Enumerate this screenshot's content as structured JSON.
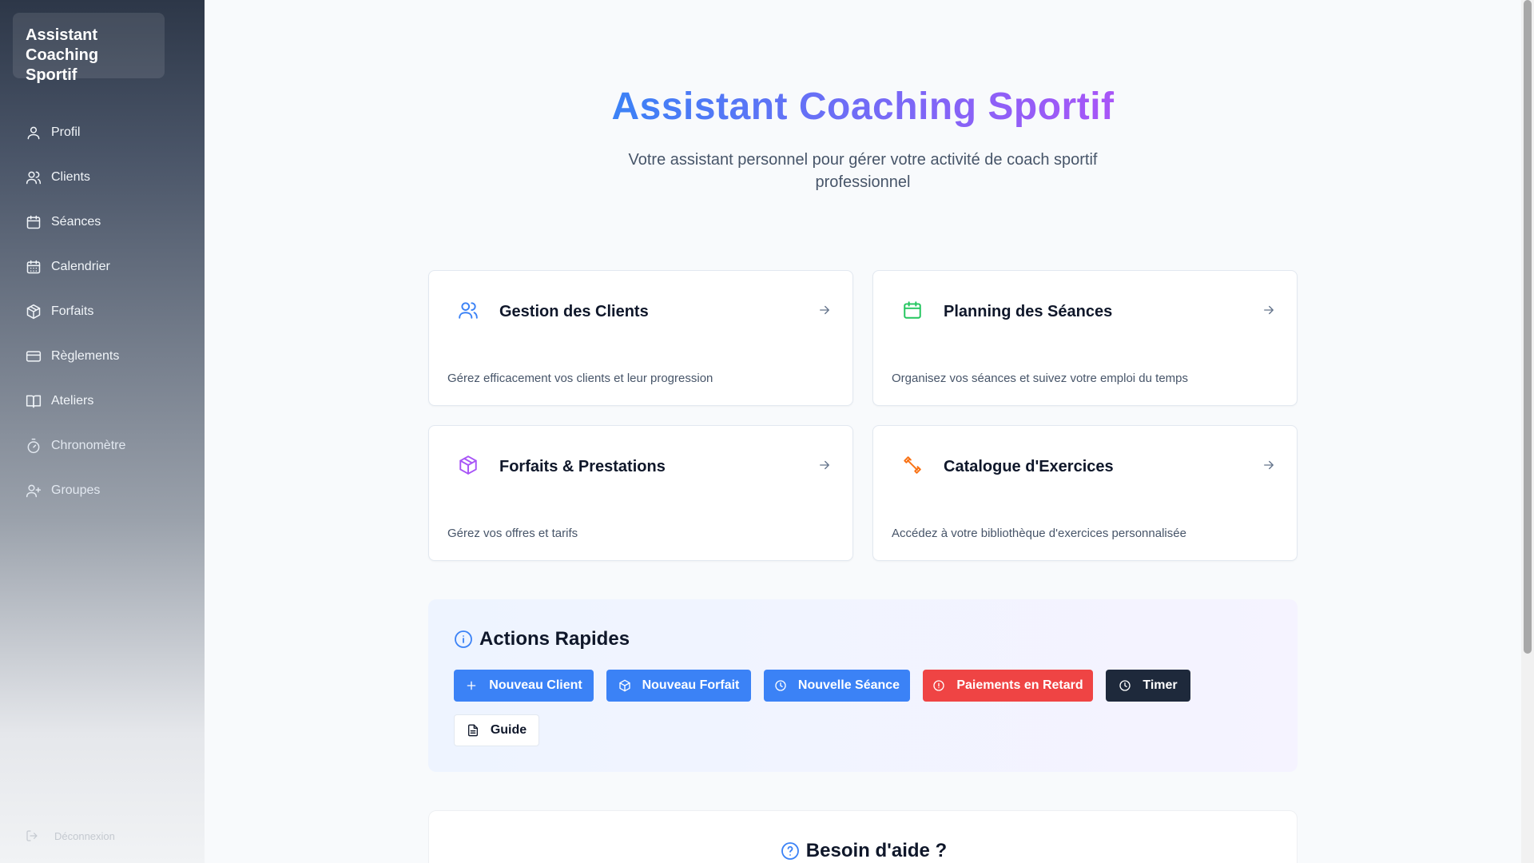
{
  "sidebar": {
    "brand": "Assistant Coaching Sportif",
    "items": [
      {
        "label": "Profil",
        "icon": "user-icon"
      },
      {
        "label": "Clients",
        "icon": "users-icon"
      },
      {
        "label": "Séances",
        "icon": "calendar-icon"
      },
      {
        "label": "Calendrier",
        "icon": "calendar-days-icon"
      },
      {
        "label": "Forfaits",
        "icon": "package-icon"
      },
      {
        "label": "Règlements",
        "icon": "credit-card-icon"
      },
      {
        "label": "Ateliers",
        "icon": "book-open-icon"
      },
      {
        "label": "Chronomètre",
        "icon": "timer-icon"
      },
      {
        "label": "Groupes",
        "icon": "user-plus-icon"
      }
    ],
    "logout": "Déconnexion"
  },
  "hero": {
    "title": "Assistant Coaching Sportif",
    "subtitle": "Votre assistant personnel pour gérer votre activité de coach sportif professionnel"
  },
  "cards": [
    {
      "title": "Gestion des Clients",
      "description": "Gérez efficacement vos clients et leur progression",
      "icon": "users-icon",
      "color": "#3b82f6"
    },
    {
      "title": "Planning des Séances",
      "description": "Organisez vos séances et suivez votre emploi du temps",
      "icon": "calendar-icon",
      "color": "#22c55e"
    },
    {
      "title": "Forfaits & Prestations",
      "description": "Gérez vos offres et tarifs",
      "icon": "package-icon",
      "color": "#a855f7"
    },
    {
      "title": "Catalogue d'Exercices",
      "description": "Accédez à votre bibliothèque d'exercices personnalisée",
      "icon": "dumbbell-icon",
      "color": "#f97316"
    }
  ],
  "actions": {
    "title": "Actions Rapides",
    "buttons": [
      {
        "label": "Nouveau Client",
        "icon": "plus-icon"
      },
      {
        "label": "Nouveau Forfait",
        "icon": "package-icon"
      },
      {
        "label": "Nouvelle Séance",
        "icon": "clock-icon"
      },
      {
        "label": "Paiements en Retard",
        "icon": "alert-circle-icon"
      },
      {
        "label": "Timer",
        "icon": "clock-icon"
      },
      {
        "label": "Guide",
        "icon": "file-text-icon"
      }
    ]
  },
  "help": {
    "title": "Besoin d'aide ?"
  },
  "colors": {
    "primary": "#3b82f6",
    "danger": "#ef4444",
    "dark": "#1e293b",
    "accent_purple": "#a855f7"
  }
}
